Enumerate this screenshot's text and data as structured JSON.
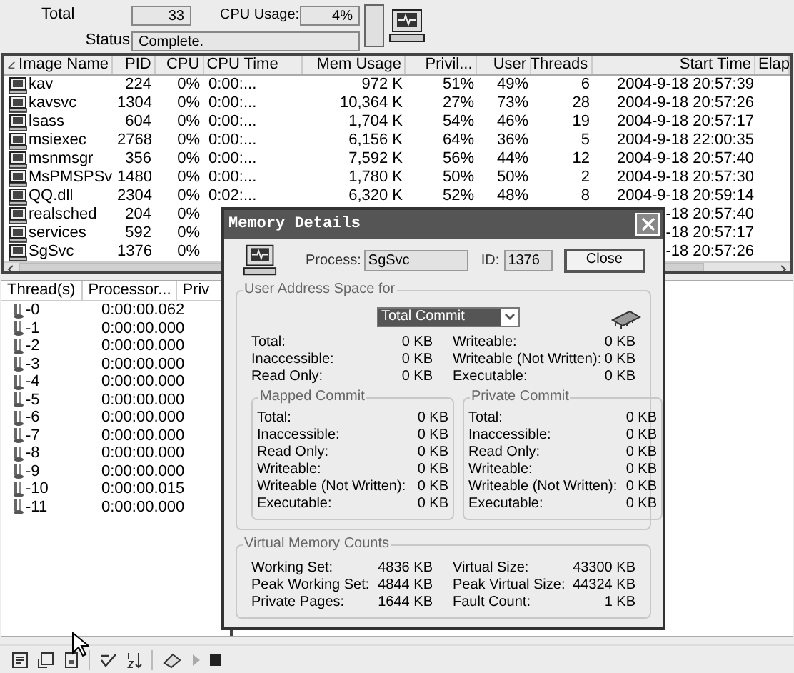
{
  "summary": {
    "total_label": "Total",
    "total": "33",
    "cpu_label": "CPU Usage:",
    "cpu": "4%",
    "status_label": "Status",
    "status": "Complete."
  },
  "process_table": {
    "columns": [
      "Image Name",
      "PID",
      "CPU",
      "CPU Time",
      "Mem Usage",
      "Privil...",
      "User",
      "Threads",
      "Start Time",
      "Elap"
    ],
    "rows": [
      {
        "name": "kav",
        "pid": "224",
        "cpu": "0%",
        "cpu_time": "0:00:...",
        "mem": "972 K",
        "privil": "51%",
        "user": "49%",
        "threads": "6",
        "start": "2004-9-18 20:57:39"
      },
      {
        "name": "kavsvc",
        "pid": "1304",
        "cpu": "0%",
        "cpu_time": "0:00:...",
        "mem": "10,364 K",
        "privil": "27%",
        "user": "73%",
        "threads": "28",
        "start": "2004-9-18 20:57:26"
      },
      {
        "name": "lsass",
        "pid": "604",
        "cpu": "0%",
        "cpu_time": "0:00:...",
        "mem": "1,704 K",
        "privil": "54%",
        "user": "46%",
        "threads": "19",
        "start": "2004-9-18 20:57:17"
      },
      {
        "name": "msiexec",
        "pid": "2768",
        "cpu": "0%",
        "cpu_time": "0:00:...",
        "mem": "6,156 K",
        "privil": "64%",
        "user": "36%",
        "threads": "5",
        "start": "2004-9-18 22:00:35"
      },
      {
        "name": "msnmsgr",
        "pid": "356",
        "cpu": "0%",
        "cpu_time": "0:00:...",
        "mem": "7,592 K",
        "privil": "56%",
        "user": "44%",
        "threads": "12",
        "start": "2004-9-18 20:57:40"
      },
      {
        "name": "MsPMSPSv",
        "pid": "1480",
        "cpu": "0%",
        "cpu_time": "0:00:...",
        "mem": "1,780 K",
        "privil": "50%",
        "user": "50%",
        "threads": "2",
        "start": "2004-9-18 20:57:30"
      },
      {
        "name": "QQ.dll",
        "pid": "2304",
        "cpu": "0%",
        "cpu_time": "0:02:...",
        "mem": "6,320 K",
        "privil": "52%",
        "user": "48%",
        "threads": "8",
        "start": "2004-9-18 20:59:14"
      },
      {
        "name": "realsched",
        "pid": "204",
        "cpu": "0%",
        "start": "-18 20:57:40"
      },
      {
        "name": "services",
        "pid": "592",
        "cpu": "0%",
        "start": "-18 20:57:17"
      },
      {
        "name": "SgSvc",
        "pid": "1376",
        "cpu": "0%",
        "start": "-18 20:57:26"
      }
    ]
  },
  "thread_table": {
    "columns": [
      "Thread(s)",
      "Processor...",
      "Priv"
    ],
    "rows": [
      {
        "name": "-0",
        "time": "0:00:00.062"
      },
      {
        "name": "-1",
        "time": "0:00:00.000"
      },
      {
        "name": "-2",
        "time": "0:00:00.000"
      },
      {
        "name": "-3",
        "time": "0:00:00.000"
      },
      {
        "name": "-4",
        "time": "0:00:00.000"
      },
      {
        "name": "-5",
        "time": "0:00:00.000"
      },
      {
        "name": "-6",
        "time": "0:00:00.000"
      },
      {
        "name": "-7",
        "time": "0:00:00.000"
      },
      {
        "name": "-8",
        "time": "0:00:00.000"
      },
      {
        "name": "-9",
        "time": "0:00:00.000"
      },
      {
        "name": "-10",
        "time": "0:00:00.015"
      },
      {
        "name": "-11",
        "time": "0:00:00.000"
      }
    ]
  },
  "dialog": {
    "title": "Memory Details",
    "process_label": "Process:",
    "process": "SgSvc",
    "id_label": "ID:",
    "id": "1376",
    "close_button": "Close",
    "address_space": {
      "title": "User Address Space for",
      "select": "Total Commit",
      "left": [
        {
          "label": "Total:",
          "value": "0 KB"
        },
        {
          "label": "Inaccessible:",
          "value": "0 KB"
        },
        {
          "label": "Read Only:",
          "value": "0 KB"
        }
      ],
      "right": [
        {
          "label": "Writeable:",
          "value": "0 KB"
        },
        {
          "label": "Writeable (Not Written):",
          "value": "0 KB"
        },
        {
          "label": "Executable:",
          "value": "0 KB"
        }
      ]
    },
    "mapped_commit": {
      "title": "Mapped Commit",
      "rows": [
        {
          "label": "Total:",
          "value": "0 KB"
        },
        {
          "label": "Inaccessible:",
          "value": "0 KB"
        },
        {
          "label": "Read Only:",
          "value": "0 KB"
        },
        {
          "label": "Writeable:",
          "value": "0 KB"
        },
        {
          "label": "Writeable (Not Written):",
          "value": "0 KB"
        },
        {
          "label": "Executable:",
          "value": "0 KB"
        }
      ]
    },
    "private_commit": {
      "title": "Private Commit",
      "rows": [
        {
          "label": "Total:",
          "value": "0 KB"
        },
        {
          "label": "Inaccessible:",
          "value": "0 KB"
        },
        {
          "label": "Read Only:",
          "value": "0 KB"
        },
        {
          "label": "Writeable:",
          "value": "0 KB"
        },
        {
          "label": "Writeable (Not Written):",
          "value": "0 KB"
        },
        {
          "label": "Executable:",
          "value": "0 KB"
        }
      ]
    },
    "virtual_memory": {
      "title": "Virtual Memory Counts",
      "left": [
        {
          "label": "Working Set:",
          "value": "4836 KB"
        },
        {
          "label": "Peak Working Set:",
          "value": "4844 KB"
        },
        {
          "label": "Private Pages:",
          "value": "1644 KB"
        }
      ],
      "right": [
        {
          "label": "Virtual Size:",
          "value": "43300 KB"
        },
        {
          "label": "Peak Virtual Size:",
          "value": "44324 KB"
        },
        {
          "label": "Fault Count:",
          "value": "1 KB"
        }
      ]
    }
  }
}
